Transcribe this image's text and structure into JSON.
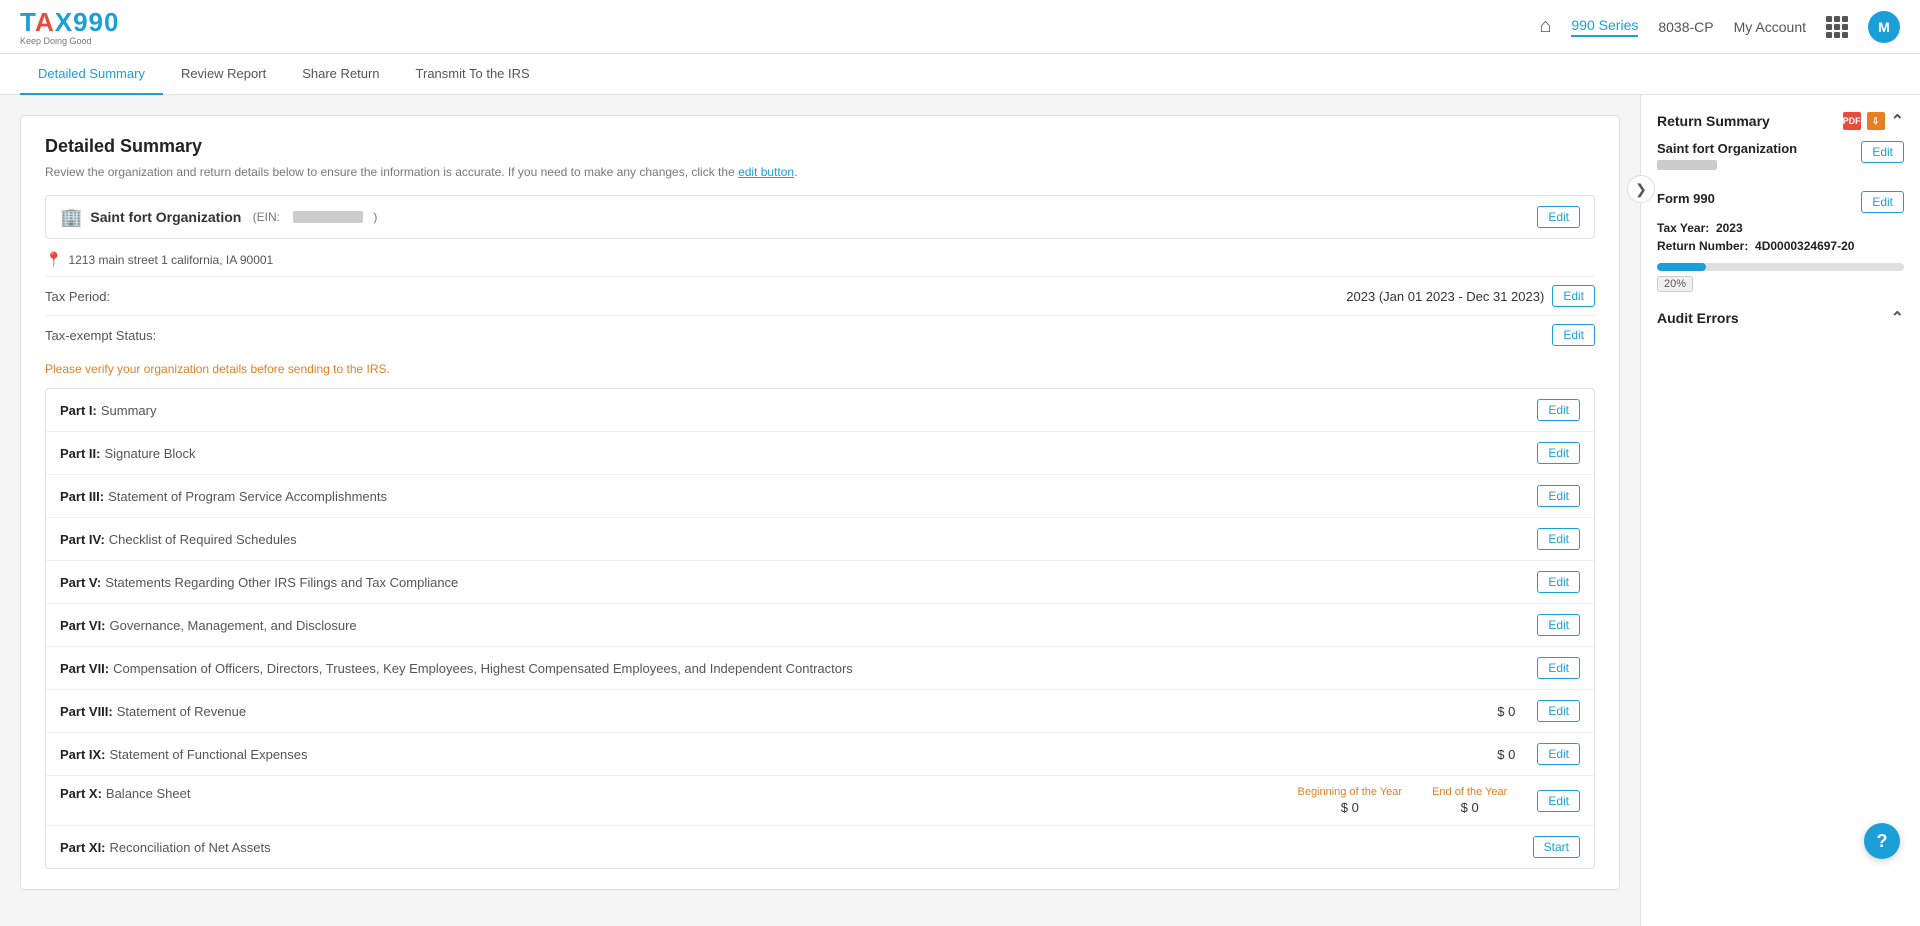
{
  "header": {
    "logo": "TAX990",
    "logo_highlight": "990",
    "tagline": "Keep Doing Good",
    "nav": {
      "series_label": "990 Series",
      "form_label": "8038-CP",
      "account_label": "My Account",
      "avatar_letter": "M"
    }
  },
  "tabs": [
    {
      "id": "detailed-summary",
      "label": "Detailed Summary",
      "active": true
    },
    {
      "id": "review-report",
      "label": "Review Report",
      "active": false
    },
    {
      "id": "share-return",
      "label": "Share Return",
      "active": false
    },
    {
      "id": "transmit-irs",
      "label": "Transmit To the IRS",
      "active": false
    }
  ],
  "main": {
    "page_title": "Detailed Summary",
    "page_subtitle": "Review the organization and return details below to ensure the information is accurate. If you need to make any changes, click the edit button.",
    "edit_link_text": "edit button",
    "org": {
      "name": "Saint fort Organization",
      "ein_label": "EIN:",
      "ein_value_hidden": true,
      "address": "1213 main street 1 california, IA 90001"
    },
    "tax_period_label": "Tax Period:",
    "tax_period_value": "2023 (Jan 01 2023 - Dec 31 2023)",
    "tax_exempt_label": "Tax-exempt Status:",
    "verify_notice": "Please verify your organization details before sending to the IRS.",
    "edit_button_label": "Edit",
    "start_button_label": "Start",
    "parts": [
      {
        "id": "part1",
        "name": "Part I:",
        "description": "Summary",
        "amount": null,
        "bot_label": null,
        "eoy_label": null,
        "show_edit": true,
        "show_start": false
      },
      {
        "id": "part2",
        "name": "Part II:",
        "description": "Signature Block",
        "amount": null,
        "bot_label": null,
        "eoy_label": null,
        "show_edit": true,
        "show_start": false
      },
      {
        "id": "part3",
        "name": "Part III:",
        "description": "Statement of Program Service Accomplishments",
        "amount": null,
        "show_edit": true,
        "show_start": false
      },
      {
        "id": "part4",
        "name": "Part IV:",
        "description": "Checklist of Required Schedules",
        "amount": null,
        "show_edit": true,
        "show_start": false
      },
      {
        "id": "part5",
        "name": "Part V:",
        "description": "Statements Regarding Other IRS Filings and Tax Compliance",
        "amount": null,
        "show_edit": true,
        "show_start": false
      },
      {
        "id": "part6",
        "name": "Part VI:",
        "description": "Governance, Management, and Disclosure",
        "amount": null,
        "show_edit": true,
        "show_start": false
      },
      {
        "id": "part7",
        "name": "Part VII:",
        "description": "Compensation of Officers, Directors, Trustees, Key Employees, Highest Compensated Employees, and Independent Contractors",
        "amount": null,
        "show_edit": true,
        "show_start": false
      },
      {
        "id": "part8",
        "name": "Part VIII:",
        "description": "Statement of Revenue",
        "amount": "$ 0",
        "show_edit": true,
        "show_start": false
      },
      {
        "id": "part9",
        "name": "Part IX:",
        "description": "Statement of Functional Expenses",
        "amount": "$ 0",
        "show_edit": true,
        "show_start": false
      },
      {
        "id": "part10",
        "name": "Part X:",
        "description": "Balance Sheet",
        "boy_label": "Beginning of the Year",
        "boy_value": "$ 0",
        "eoy_label": "End of the Year",
        "eoy_value": "$ 0",
        "show_edit": true,
        "show_start": false
      },
      {
        "id": "part11",
        "name": "Part XI:",
        "description": "Reconciliation of Net Assets",
        "amount": null,
        "show_edit": false,
        "show_start": true
      }
    ]
  },
  "sidebar": {
    "return_summary_title": "Return Summary",
    "org_name": "Saint fort Organization",
    "form_label": "Form 990",
    "tax_year_label": "Tax Year:",
    "tax_year_value": "2023",
    "return_number_label": "Return Number:",
    "return_number_value": "4D0000324697-20",
    "progress_percent": 20,
    "progress_label": "20%",
    "audit_errors_title": "Audit Errors"
  }
}
